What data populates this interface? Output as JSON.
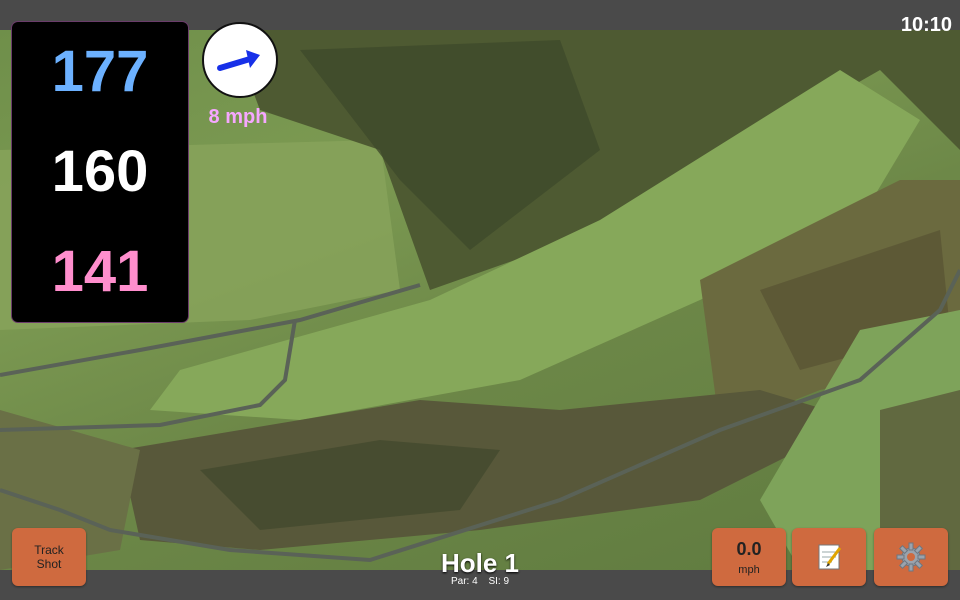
{
  "status": {
    "time": "10:10"
  },
  "distances": {
    "back": "177",
    "middle": "160",
    "front": "141"
  },
  "wind": {
    "speed_label": "8 mph",
    "icon": "wind-arrow-icon"
  },
  "buttons": {
    "track_shot_line1": "Track",
    "track_shot_line2": "Shot",
    "speed_value": "0.0",
    "speed_unit": "mph",
    "notes_icon": "notepad-icon",
    "settings_icon": "gear-icon"
  },
  "hole": {
    "title": "Hole 1",
    "par": "Par: 4",
    "si": "SI: 9"
  },
  "colors": {
    "back_distance": "#6cb1ff",
    "middle_distance": "#ffffff",
    "front_distance": "#ff8ecd",
    "wind_label": "#f6a7ff",
    "button_bg": "#cf6a3f"
  }
}
